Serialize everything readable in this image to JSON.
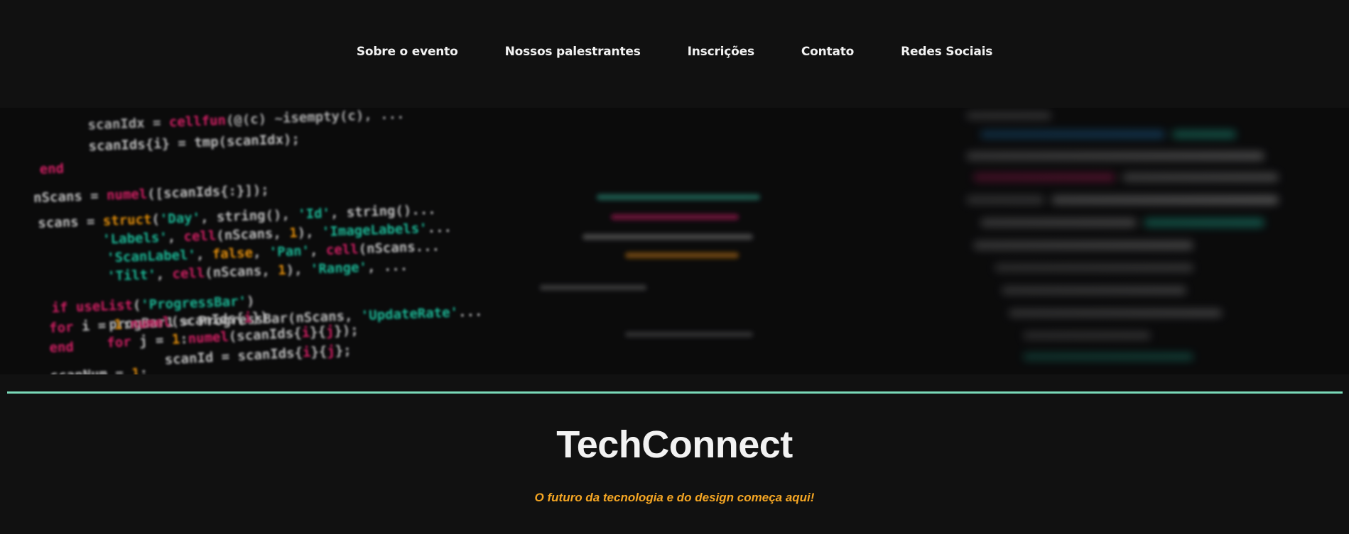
{
  "nav": {
    "items": [
      {
        "label": "Sobre o evento"
      },
      {
        "label": "Nossos palestrantes"
      },
      {
        "label": "Inscrições"
      },
      {
        "label": "Contato"
      },
      {
        "label": "Redes Sociais"
      }
    ]
  },
  "hero": {
    "image_icon": "code-editor-background-image"
  },
  "main": {
    "title": "TechConnect",
    "subtitle": "O futuro da tecnologia e do design começa aqui!"
  },
  "colors": {
    "background": "#111111",
    "divider": "#7ad9b8",
    "title": "#f2f2f2",
    "subtitle": "#f5a623"
  }
}
